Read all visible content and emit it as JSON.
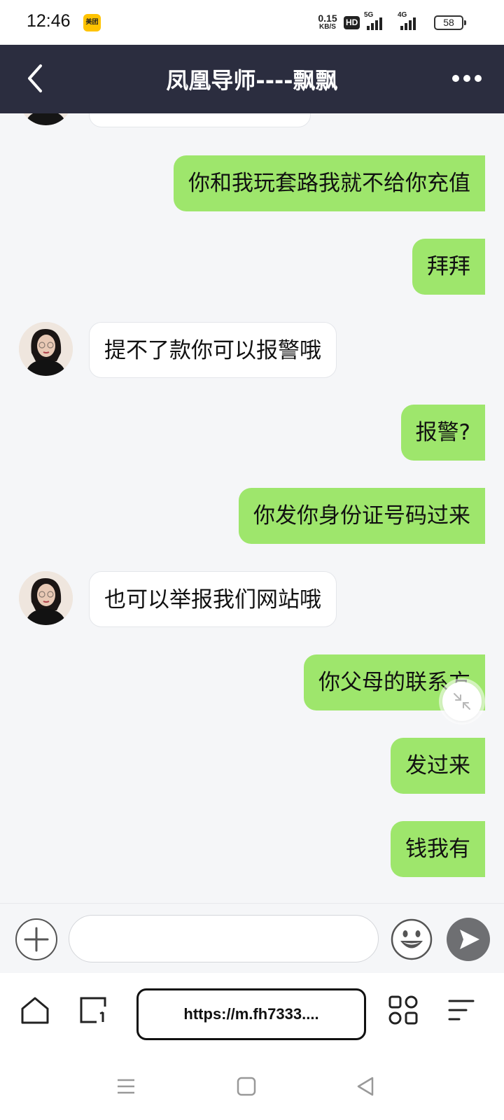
{
  "status_bar": {
    "time": "12:46",
    "app_badge": "美团",
    "net_speed_value": "0.15",
    "net_speed_unit": "KB/S",
    "hd_label": "HD",
    "signal_1": "5G",
    "signal_2": "4G",
    "battery": "58"
  },
  "header": {
    "title": "凤凰导师----飘飘",
    "back_icon": "chevron-left-icon",
    "more_icon": "more-dots-icon"
  },
  "colors": {
    "header_bg": "#2b2d3f",
    "my_bubble": "#9ee66c",
    "their_bubble": "#ffffff",
    "chat_bg": "#f5f6f8"
  },
  "messages": [
    {
      "from": "me",
      "text": "你和我玩套路我就不给你充值"
    },
    {
      "from": "me",
      "text": "拜拜"
    },
    {
      "from": "them",
      "text": "提不了款你可以报警哦"
    },
    {
      "from": "me",
      "text": "报警?"
    },
    {
      "from": "me",
      "text": "你发你身份证号码过来"
    },
    {
      "from": "them",
      "text": "也可以举报我们网站哦"
    },
    {
      "from": "me",
      "text": "你父母的联系方"
    },
    {
      "from": "me",
      "text": "发过来"
    },
    {
      "from": "me",
      "text": "钱我有"
    }
  ],
  "input": {
    "value": "",
    "placeholder": ""
  },
  "browser": {
    "url": "https://m.fh7333...."
  }
}
